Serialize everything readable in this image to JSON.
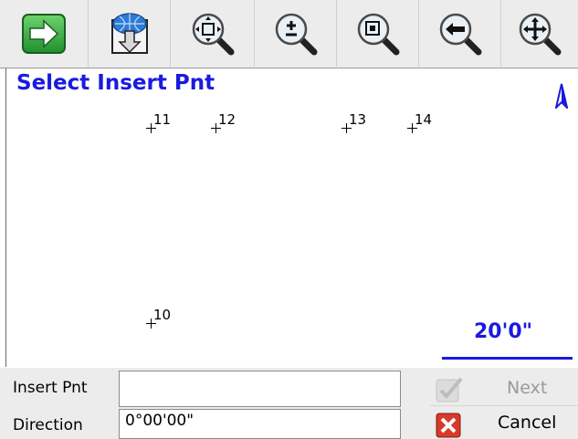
{
  "toolbar": {
    "buttons": [
      {
        "icon": "green-arrow-right-icon"
      },
      {
        "icon": "globe-download-icon"
      },
      {
        "icon": "zoom-extents-icon"
      },
      {
        "icon": "zoom-in-out-icon"
      },
      {
        "icon": "zoom-window-icon"
      },
      {
        "icon": "zoom-previous-icon"
      },
      {
        "icon": "pan-icon"
      }
    ]
  },
  "map": {
    "title": "Select Insert Pnt",
    "points": [
      "11",
      "12",
      "13",
      "14",
      "10"
    ],
    "scale_label": "20'0\"",
    "colors": {
      "accent": "#1a1ae0"
    }
  },
  "form": {
    "insert_label": "Insert Pnt",
    "insert_value": "",
    "direction_label": "Direction",
    "direction_value": "0°00'00\"",
    "next_label": "Next",
    "cancel_label": "Cancel"
  }
}
